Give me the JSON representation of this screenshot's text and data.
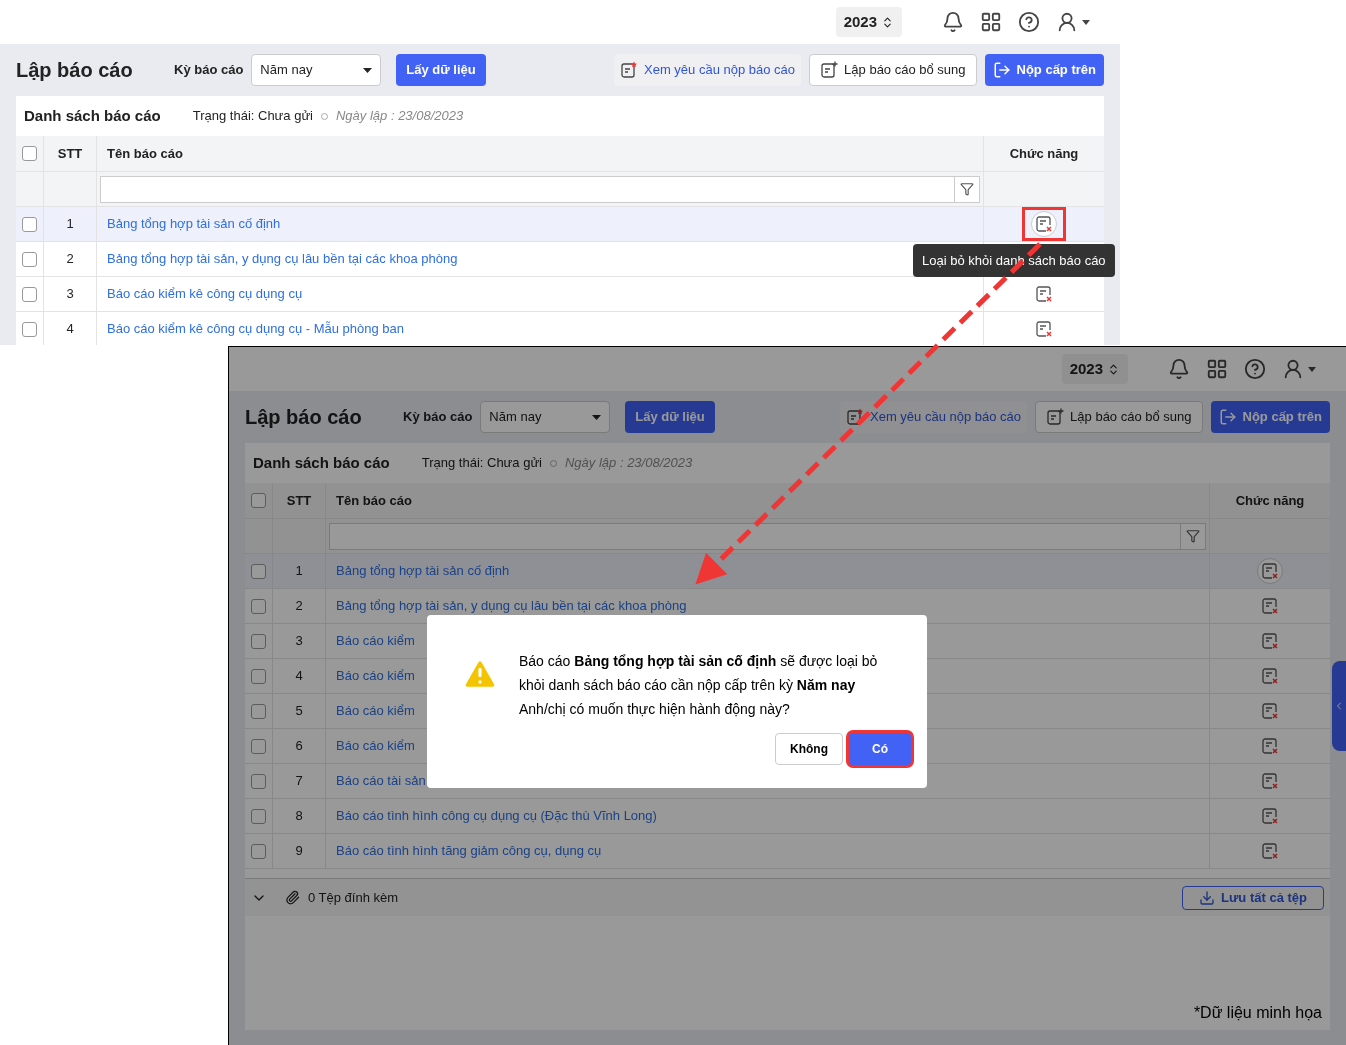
{
  "screenshots": [
    {
      "header": {
        "year": "2023"
      },
      "page": {
        "title": "Lập báo cáo",
        "period_label": "Kỳ báo cáo",
        "period_value": "Năm nay",
        "fetch_button": "Lấy dữ liệu",
        "buttons": [
          {
            "label": "Xem yêu cầu nộp báo cáo",
            "kind": "request"
          },
          {
            "label": "Lập báo cáo bổ sung",
            "kind": "add"
          },
          {
            "label": "Nộp cấp trên",
            "kind": "submit"
          }
        ]
      },
      "list": {
        "title": "Danh sách báo cáo",
        "status": "Trạng thái: Chưa gửi",
        "date": "Ngày lập : 23/08/2023"
      },
      "table": {
        "columns": [
          "STT",
          "Tên báo cáo",
          "Chức năng"
        ],
        "all_checked": false,
        "rows": [
          {
            "stt": "1",
            "name": "Bảng tổng hợp tài sản cố định",
            "checked": false,
            "selected": true,
            "outlined": true
          },
          {
            "stt": "2",
            "name": "Bảng tổng hợp tài sản, y dụng cụ lâu bền tại các khoa phòng",
            "checked": false,
            "selected": false,
            "outlined": false,
            "action_visible": false
          },
          {
            "stt": "3",
            "name": "Báo cáo kiểm kê công cụ dụng cụ",
            "checked": false,
            "selected": false,
            "outlined": false
          },
          {
            "stt": "4",
            "name": "Báo cáo kiểm kê công cụ dụng cụ - Mẫu phòng ban",
            "checked": false,
            "selected": false,
            "outlined": false
          }
        ]
      },
      "tooltip": "Loại bỏ khỏi danh sách báo cáo"
    },
    {
      "header": {
        "year": "2023"
      },
      "page": {
        "title": "Lập báo cáo",
        "period_label": "Kỳ báo cáo",
        "period_value": "Năm nay",
        "fetch_button": "Lấy dữ liệu",
        "buttons": [
          {
            "label": "Xem yêu cầu nộp báo cáo",
            "kind": "request"
          },
          {
            "label": "Lập báo cáo bổ sung",
            "kind": "add"
          },
          {
            "label": "Nộp cấp trên",
            "kind": "submit"
          }
        ]
      },
      "list": {
        "title": "Danh sách báo cáo",
        "status": "Trạng thái: Chưa gửi",
        "date": "Ngày lập : 23/08/2023"
      },
      "table": {
        "columns": [
          "STT",
          "Tên báo cáo",
          "Chức năng"
        ],
        "all_checked": false,
        "rows": [
          {
            "stt": "1",
            "name": "Bảng tổng hợp tài sản cố định",
            "checked": false,
            "selected": true,
            "outlined": false
          },
          {
            "stt": "2",
            "name": "Bảng tổng hợp tài sản, y dụng cụ lâu bền tại các khoa phòng",
            "checked": false,
            "selected": false,
            "outlined": false
          },
          {
            "stt": "3",
            "name": "Báo cáo kiểm",
            "checked": false,
            "selected": false,
            "outlined": false
          },
          {
            "stt": "4",
            "name": "Báo cáo kiểm",
            "checked": false,
            "selected": false,
            "outlined": false
          },
          {
            "stt": "5",
            "name": "Báo cáo kiểm",
            "checked": false,
            "selected": false,
            "outlined": false
          },
          {
            "stt": "6",
            "name": "Báo cáo kiểm",
            "checked": false,
            "selected": false,
            "outlined": false
          },
          {
            "stt": "7",
            "name": "Báo cáo tài sản",
            "checked": false,
            "selected": false,
            "outlined": false
          },
          {
            "stt": "8",
            "name": "Báo cáo tình hình công cụ dụng cụ (Đặc thù Vĩnh Long)",
            "checked": false,
            "selected": false,
            "outlined": false
          },
          {
            "stt": "9",
            "name": "Báo cáo tình hình tăng giảm công cụ, dụng cụ",
            "checked": false,
            "selected": false,
            "outlined": false
          }
        ]
      },
      "footer": {
        "attachments": "0 Tệp đính kèm",
        "save_button": "Lưu tất cả tệp"
      },
      "dialog": {
        "message": "Báo cáo **Bảng tổng hợp tài sản cố định** sẽ được loại bỏ khỏi danh sách báo cáo cần nộp cấp trên kỳ **Năm nay**",
        "question": "Anh/chị có muốn thực hiện hành động này?",
        "buttons": [
          {
            "label": "Không",
            "kind": "cancel",
            "outlined": false
          },
          {
            "label": "Có",
            "kind": "confirm",
            "outlined": true
          }
        ]
      },
      "note": "*Dữ liệu minh họa"
    }
  ]
}
